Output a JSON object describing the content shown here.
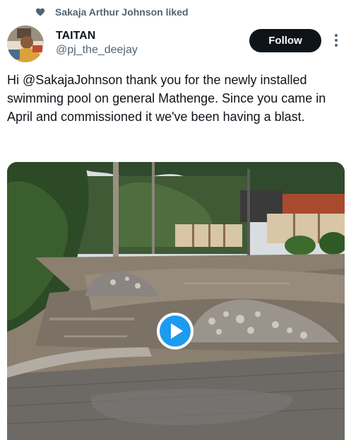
{
  "social_context": {
    "text": "Sakaja Arthur Johnson liked",
    "icon": "heart-icon"
  },
  "author": {
    "display_name": "TAITAN",
    "handle": "@pj_the_deejay"
  },
  "actions": {
    "follow_label": "Follow",
    "more_icon": "more-icon"
  },
  "tweet": {
    "text": "Hi @SakajaJohnson thank you for the newly installed swimming pool on general Mathenge. Since you came in April and commissioned it we've been having a blast."
  },
  "media": {
    "type": "video",
    "play_icon": "play-icon",
    "accent": "#1d9bf0"
  }
}
